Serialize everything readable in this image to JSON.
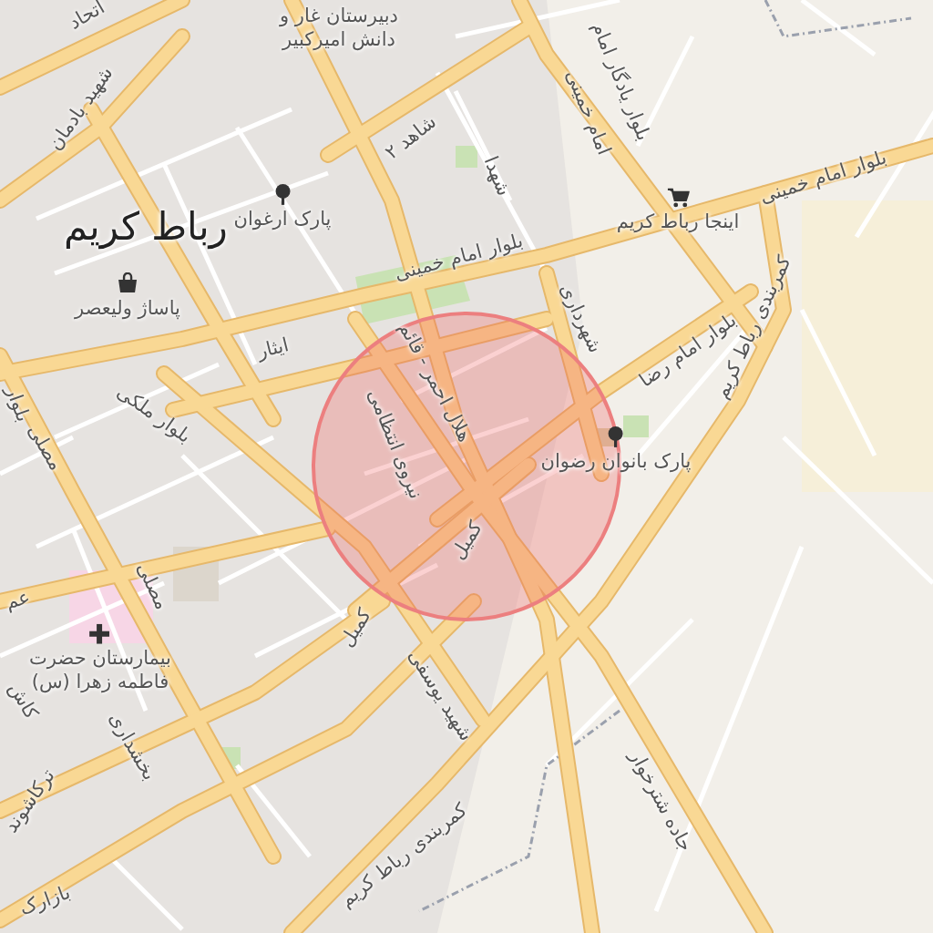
{
  "map": {
    "labels": [
      {
        "kind": "park",
        "text": "پارک ارغوان"
      },
      {
        "kind": "city",
        "text": "رباط کریم"
      },
      {
        "kind": "shop",
        "text": "پاساژ ولیعصر"
      },
      {
        "kind": "poi",
        "lines": [
          "دبیرستان غار و",
          "دانش امیرکبیر"
        ]
      },
      {
        "kind": "road",
        "text": "اتحاد"
      },
      {
        "kind": "road",
        "text": "شهید بادمان"
      },
      {
        "kind": "road",
        "text": "شاهد ۲"
      },
      {
        "kind": "road",
        "text": "شهدا"
      },
      {
        "kind": "road",
        "text": "امام خمینی"
      },
      {
        "kind": "road",
        "text": "بلوار یادگار امام"
      },
      {
        "kind": "road",
        "text": "بلوار امام خمینی"
      },
      {
        "kind": "cart",
        "text": "اینجا رباط کریم"
      },
      {
        "kind": "road",
        "text": "بلوار امام خمینی"
      },
      {
        "kind": "road",
        "text": "شهرداری"
      },
      {
        "kind": "road",
        "text": "بلوار امام رضا"
      },
      {
        "kind": "road",
        "text": "کمربندی رباط کریم"
      },
      {
        "kind": "road",
        "text": "ایثار"
      },
      {
        "kind": "road",
        "text": "بلوار ملکی"
      },
      {
        "kind": "road",
        "text": "بلوار"
      },
      {
        "kind": "road",
        "text": "مصلی"
      },
      {
        "kind": "road",
        "text": "هلال احمر - قائم"
      },
      {
        "kind": "road",
        "text": "نیروی انتظامی"
      },
      {
        "kind": "park",
        "text": "پارک بانوان رضوان"
      },
      {
        "kind": "road",
        "text": "کمیل"
      },
      {
        "kind": "road",
        "text": "عم"
      },
      {
        "kind": "hospital",
        "lines": [
          "بیمارستان حضرت",
          "فاطمه زهرا (س)"
        ]
      },
      {
        "kind": "road",
        "text": "مصلی"
      },
      {
        "kind": "road",
        "text": "کمیل"
      },
      {
        "kind": "road",
        "text": "کاش"
      },
      {
        "kind": "road",
        "text": "شهید یوسفی"
      },
      {
        "kind": "road",
        "text": "بخشداری"
      },
      {
        "kind": "road",
        "text": "ترکاشوند"
      },
      {
        "kind": "road",
        "text": "جاده شترخوار"
      },
      {
        "kind": "road",
        "text": "کمربندی رباط کریم"
      },
      {
        "kind": "road",
        "text": "بازارک"
      }
    ]
  }
}
